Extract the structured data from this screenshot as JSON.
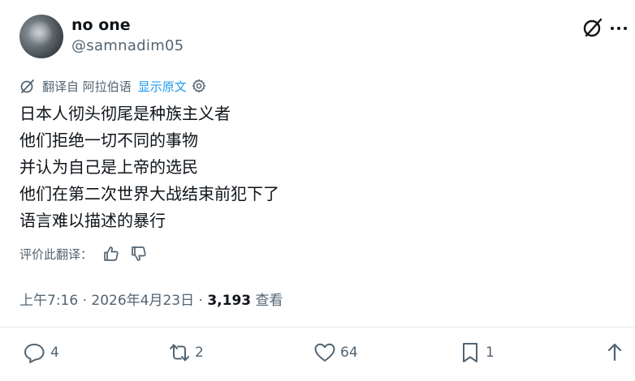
{
  "user": {
    "display_name": "no one",
    "handle": "@samnadim05"
  },
  "translation": {
    "label": "翻译自 阿拉伯语",
    "show_original": "显示原文"
  },
  "tweet": {
    "lines": [
      "日本人彻头彻尾是种族主义者",
      "他们拒绝一切不同的事物",
      "并认为自己是上帝的选民",
      "他们在第二次世界大战结束前犯下了",
      "语言难以描述的暴行"
    ]
  },
  "rate": {
    "label": "评价此翻译："
  },
  "meta": {
    "time": "上午7:16",
    "sep": " · ",
    "date": "2026年4月23日",
    "sep2": " · ",
    "views": "3,193",
    "views_label": " 查看"
  },
  "actions": {
    "replies": "4",
    "reposts": "2",
    "likes": "64",
    "bookmarks": "1"
  },
  "colors": {
    "link": "#1d9bf0",
    "muted": "#536471",
    "text": "#0f1419"
  }
}
